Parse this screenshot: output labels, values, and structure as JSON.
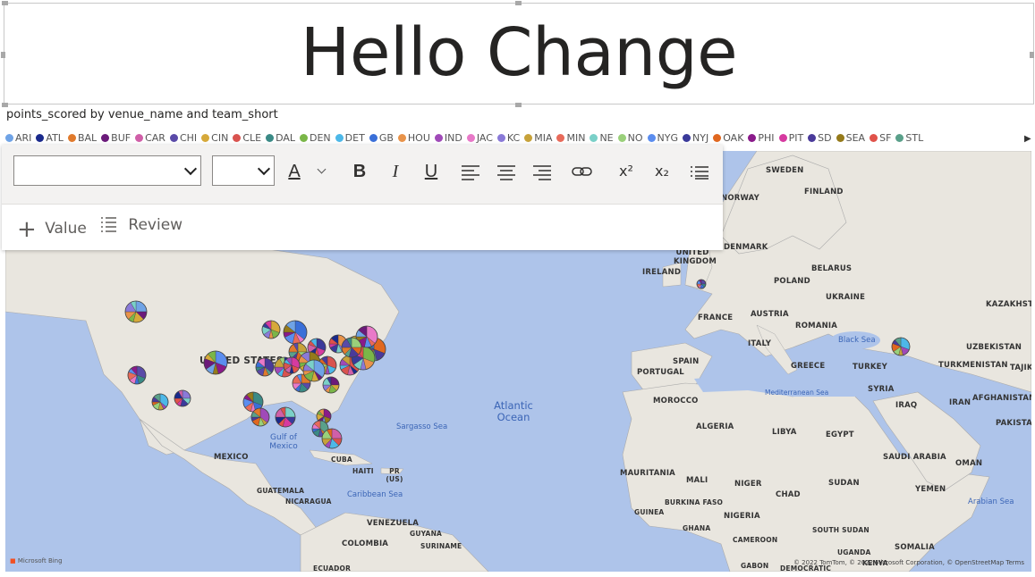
{
  "header": {
    "title": "Hello Change"
  },
  "visual": {
    "subtitle": "points_scored by venue_name and team_short"
  },
  "legend": {
    "items": [
      {
        "label": "ARI",
        "color": "#6fa3e6"
      },
      {
        "label": "ATL",
        "color": "#1a2a8c"
      },
      {
        "label": "BAL",
        "color": "#e07a2c"
      },
      {
        "label": "BUF",
        "color": "#6b1a7a"
      },
      {
        "label": "CAR",
        "color": "#d05fa8"
      },
      {
        "label": "CHI",
        "color": "#5a4aa8"
      },
      {
        "label": "CIN",
        "color": "#d6a93a"
      },
      {
        "label": "CLE",
        "color": "#d9534f"
      },
      {
        "label": "DAL",
        "color": "#3a8a86"
      },
      {
        "label": "DEN",
        "color": "#7ab648"
      },
      {
        "label": "DET",
        "color": "#4db8e8"
      },
      {
        "label": "GB",
        "color": "#3a6fd8"
      },
      {
        "label": "HOU",
        "color": "#e8934a"
      },
      {
        "label": "IND",
        "color": "#a04ab8"
      },
      {
        "label": "JAC",
        "color": "#e879c8"
      },
      {
        "label": "KC",
        "color": "#8a7ad8"
      },
      {
        "label": "MIA",
        "color": "#c7a23a"
      },
      {
        "label": "MIN",
        "color": "#e86a5a"
      },
      {
        "label": "NE",
        "color": "#7ad0c8"
      },
      {
        "label": "NO",
        "color": "#9ad07a"
      },
      {
        "label": "NYG",
        "color": "#5b8def"
      },
      {
        "label": "NYJ",
        "color": "#3a3a9a"
      },
      {
        "label": "OAK",
        "color": "#e0671f"
      },
      {
        "label": "PHI",
        "color": "#8a1a8a"
      },
      {
        "label": "PIT",
        "color": "#d63aa0"
      },
      {
        "label": "SD",
        "color": "#4a3a9a"
      },
      {
        "label": "SEA",
        "color": "#957a1a"
      },
      {
        "label": "SF",
        "color": "#e0524a"
      },
      {
        "label": "STL",
        "color": "#5aa08a"
      }
    ]
  },
  "toolbar": {
    "font_value": "",
    "size_value": "",
    "font_color_label": "A",
    "bold_label": "B",
    "italic_label": "I",
    "underline_label": "U",
    "superscript_label": "x²",
    "subscript_label": "x₂",
    "value_label": "Value",
    "review_label": "Review"
  },
  "map": {
    "labels": {
      "sweden": "SWEDEN",
      "finland": "FINLAND",
      "norway": "NORWAY",
      "denmark": "DENMARK",
      "uk": "UNITED KINGDOM",
      "ireland": "IRELAND",
      "belarus": "BELARUS",
      "poland": "POLAND",
      "ukraine": "UKRAINE",
      "kazakhstan": "KAZAKHSTAN",
      "france": "FRANCE",
      "austria": "AUSTRIA",
      "romania": "ROMANIA",
      "italy": "ITALY",
      "spain": "SPAIN",
      "portugal": "PORTUGAL",
      "greece": "GREECE",
      "turkey": "TURKEY",
      "uzbekistan": "UZBEKISTAN",
      "turkmenistan": "TURKMENISTAN",
      "tajik": "TAJIKI",
      "syria": "SYRIA",
      "iraq": "IRAQ",
      "iran": "IRAN",
      "afghanistan": "AFGHANISTAN",
      "pakistan": "PAKISTAN",
      "morocco": "MOROCCO",
      "algeria": "ALGERIA",
      "libya": "LIBYA",
      "egypt": "EGYPT",
      "saudi": "SAUDI ARABIA",
      "oman": "OMAN",
      "yemen": "YEMEN",
      "sudan": "SUDAN",
      "chad": "CHAD",
      "niger": "NIGER",
      "mali": "MALI",
      "mauritania": "MAURITANIA",
      "burkina": "BURKINA FASO",
      "guinea": "GUINEA",
      "ghana": "GHANA",
      "nigeria": "NIGERIA",
      "cameroon": "CAMEROON",
      "southsudan": "SOUTH SUDAN",
      "uganda": "UGANDA",
      "kenya": "KENYA",
      "somalia": "SOMALIA",
      "gabon": "GABON",
      "drc": "DEMOCRATIC",
      "us": "UNITED STATES",
      "mexico": "MEXICO",
      "cuba": "CUBA",
      "haiti": "HAITI",
      "pr": "PR (US)",
      "guatemala": "GUATEMALA",
      "nicaragua": "NICARAGUA",
      "venezuela": "VENEZUELA",
      "guyana": "GUYANA",
      "suriname": "SURINAME",
      "colombia": "COLOMBIA",
      "ecuador": "ECUADOR"
    },
    "water": {
      "atlantic": "Atlantic Ocean",
      "sargasso": "Sargasso Sea",
      "gulf": "Gulf of Mexico",
      "caribbean": "Caribbean Sea",
      "black": "Black Sea",
      "med": "Mediterranean Sea",
      "arabian": "Arabian Sea"
    },
    "attribution": "© 2022 TomTom, © 2022 Microsoft Corporation, © OpenStreetMap  Terms",
    "provider": "Microsoft Bing"
  },
  "markers": [
    {
      "location": "Seattle"
    },
    {
      "location": "San Francisco"
    },
    {
      "location": "Los Angeles"
    },
    {
      "location": "San Diego"
    },
    {
      "location": "Phoenix"
    },
    {
      "location": "Denver"
    },
    {
      "location": "Kansas City"
    },
    {
      "location": "Minneapolis"
    },
    {
      "location": "Green Bay"
    },
    {
      "location": "Chicago"
    },
    {
      "location": "Detroit"
    },
    {
      "location": "Indianapolis"
    },
    {
      "location": "St. Louis"
    },
    {
      "location": "Cincinnati"
    },
    {
      "location": "Cleveland"
    },
    {
      "location": "Pittsburgh"
    },
    {
      "location": "Buffalo"
    },
    {
      "location": "New England"
    },
    {
      "location": "New York"
    },
    {
      "location": "Philadelphia"
    },
    {
      "location": "Baltimore"
    },
    {
      "location": "Washington"
    },
    {
      "location": "Charlotte"
    },
    {
      "location": "Nashville"
    },
    {
      "location": "Atlanta"
    },
    {
      "location": "Dallas"
    },
    {
      "location": "Houston"
    },
    {
      "location": "New Orleans"
    },
    {
      "location": "Jacksonville"
    },
    {
      "location": "Tampa"
    },
    {
      "location": "London"
    },
    {
      "location": "Istanbul"
    }
  ]
}
